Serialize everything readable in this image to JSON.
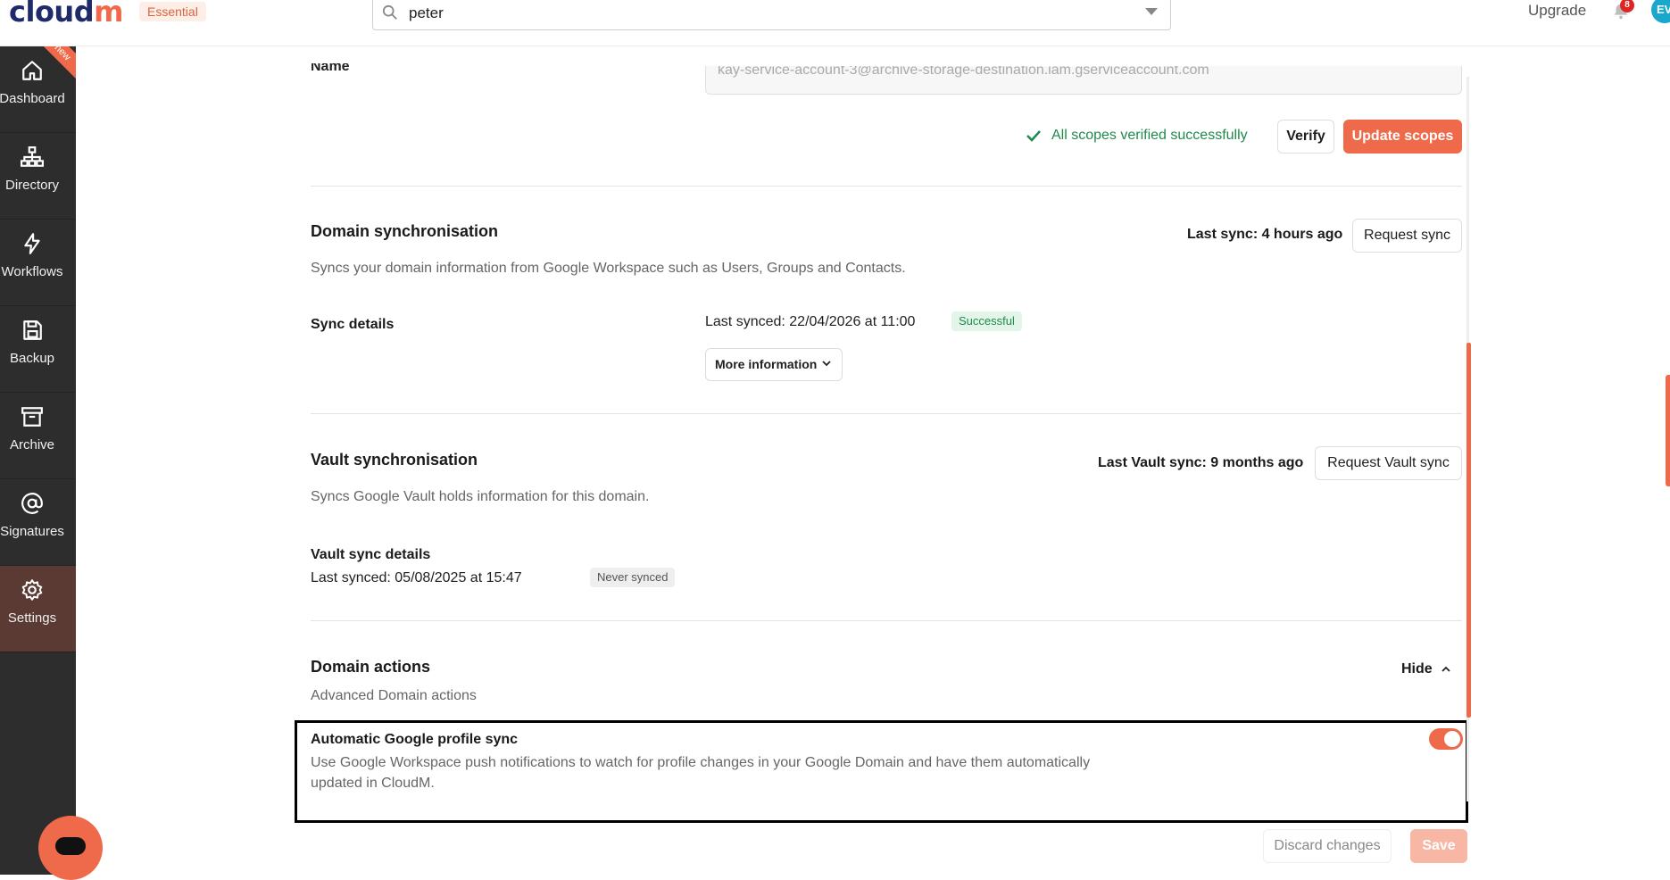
{
  "app": {
    "logo_text": "cloud",
    "logo_accent": "m",
    "plan_badge": "Essential",
    "brand_color": "#ef6a4a"
  },
  "search": {
    "value": "peter"
  },
  "header": {
    "upgrade_label": "Upgrade",
    "notification_count": "8",
    "avatar_initials": "EV"
  },
  "sidebar": {
    "new_ribbon": "new",
    "items": [
      {
        "label": "Dashboard",
        "icon": "home-icon"
      },
      {
        "label": "Directory",
        "icon": "sitemap-icon"
      },
      {
        "label": "Workflows",
        "icon": "lightning-icon"
      },
      {
        "label": "Backup",
        "icon": "save-icon"
      },
      {
        "label": "Archive",
        "icon": "archive-box-icon"
      },
      {
        "label": "Signatures",
        "icon": "at-icon"
      },
      {
        "label": "Settings",
        "icon": "gear-icon",
        "active": true
      }
    ]
  },
  "service_account": {
    "label": "Name",
    "value": "kay-service-account-3@archive-storage-destination.iam.gserviceaccount.com",
    "verified_message": "All scopes verified successfully",
    "verify_button": "Verify",
    "update_scopes_button": "Update scopes"
  },
  "domain_sync": {
    "title": "Domain synchronisation",
    "description": "Syncs your domain information from Google Workspace such as Users, Groups and Contacts.",
    "last_sync": "Last sync: 4 hours ago",
    "request_button": "Request sync",
    "details_label": "Sync details",
    "last_synced": "Last synced: 22/04/2026 at 11:00",
    "status": "Successful",
    "more_info_button": "More information"
  },
  "vault_sync": {
    "title": "Vault synchronisation",
    "description": "Syncs Google Vault holds information for this domain.",
    "last_sync": "Last Vault sync: 9 months ago",
    "request_button": "Request Vault sync",
    "details_label": "Vault sync details",
    "last_synced": "Last synced: 05/08/2025 at 15:47",
    "status": "Never synced"
  },
  "domain_actions": {
    "title": "Domain actions",
    "description": "Advanced Domain actions",
    "toggle_label": "Hide",
    "auto_sync": {
      "title": "Automatic Google profile sync",
      "description_line1": "Use Google Workspace push notifications to watch for profile changes in your Google Domain and have them automatically",
      "description_line2": "updated in CloudM.",
      "enabled": true
    }
  },
  "footer": {
    "discard_button": "Discard changes",
    "save_button": "Save"
  }
}
